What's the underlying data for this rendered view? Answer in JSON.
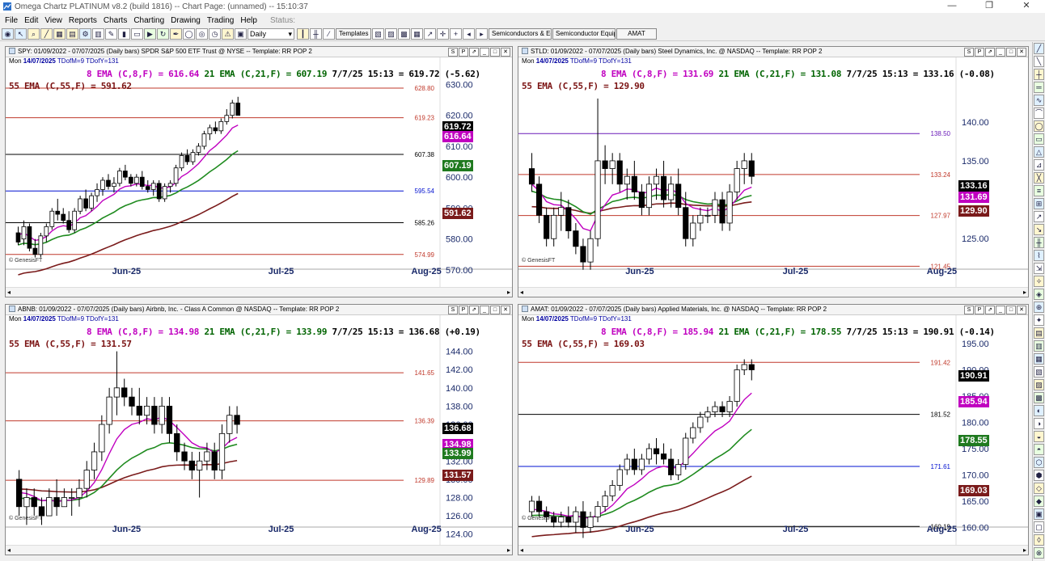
{
  "window": {
    "title": "Omega Chartz PLATINUM v8.2 (build 1816)  --  Chart Page: (unnamed) -- 15:10:37",
    "minimize": "—",
    "restore": "❐",
    "close": "✕"
  },
  "menu": [
    "File",
    "Edit",
    "View",
    "Reports",
    "Charts",
    "Charting",
    "Drawing",
    "Trading",
    "Help"
  ],
  "status_label": "Status:",
  "toolbar": {
    "period": "Daily",
    "templates": "Templates",
    "sym1": "Semiconductors & Equi",
    "sym2": "Semiconductor Equipm",
    "sym3": "AMAT"
  },
  "colors": {
    "ema8": "#c000c0",
    "ema21": "#1f8b1f",
    "ema55": "#7a1b1b",
    "price_line": "#000000",
    "sr_line": "#c0392b",
    "blue_line": "#0010d0",
    "purple_line": "#6a1bb8"
  },
  "panes": [
    {
      "id": "spy",
      "header": "SPY: 01/09/2022 - 07/07/2025  (Daily bars)   SPDR S&P 500 ETF Trust @ NYSE  --  Template: RR POP 2",
      "date_line": {
        "day": "Mon",
        "date": "14/07/2025",
        "tdm": "TDofM=9",
        "tdy": "TDofY=131"
      },
      "ema8": "8 EMA (C,8,F) = 616.64",
      "ema21": "21 EMA (C,21,F) = 607.19",
      "quote": "7/7/25 15:13 = 619.72 (-5.62)",
      "ema55": "55 EMA (C,55,F) = 591.62",
      "yaxis": {
        "min": 565,
        "max": 633,
        "ticks": [
          "570.00",
          "580.00",
          "590.00",
          "600.00",
          "610.00",
          "620.00",
          "630.00"
        ]
      },
      "hlines": [
        {
          "v": 628.8,
          "label": "628.80",
          "c": "#c0392b"
        },
        {
          "v": 619.23,
          "label": "619.23",
          "c": "#c0392b"
        },
        {
          "v": 607.38,
          "label": "607.38",
          "c": "#000000"
        },
        {
          "v": 595.54,
          "label": "595.54",
          "c": "#0010d0"
        },
        {
          "v": 585.26,
          "label": "585.26",
          "c": "#000000"
        },
        {
          "v": 574.99,
          "label": "574.99",
          "c": "#c0392b"
        }
      ],
      "tags": [
        {
          "v": 619.72,
          "label": "619.72",
          "bg": "#000000"
        },
        {
          "v": 616.64,
          "label": "616.64",
          "bg": "#c000c0"
        },
        {
          "v": 607.19,
          "label": "607.19",
          "bg": "#1f7a1f"
        },
        {
          "v": 591.62,
          "label": "591.62",
          "bg": "#7a1b1b"
        }
      ],
      "xlabels": [
        "Jun-25",
        "Jul-25",
        "Aug-25"
      ],
      "gf": "© GenesisFT",
      "candles": [
        [
          582,
          584,
          578,
          579
        ],
        [
          580,
          586,
          578,
          584
        ],
        [
          584,
          585,
          576,
          577
        ],
        [
          577,
          580,
          574,
          575
        ],
        [
          575,
          582,
          574,
          581
        ],
        [
          581,
          585,
          579,
          584
        ],
        [
          584,
          590,
          583,
          589
        ],
        [
          589,
          593,
          586,
          588
        ],
        [
          588,
          590,
          585,
          586
        ],
        [
          586,
          589,
          582,
          583
        ],
        [
          583,
          590,
          582,
          589
        ],
        [
          589,
          594,
          588,
          593
        ],
        [
          593,
          596,
          589,
          590
        ],
        [
          590,
          595,
          589,
          594
        ],
        [
          594,
          598,
          592,
          596
        ],
        [
          596,
          600,
          594,
          599
        ],
        [
          599,
          601,
          596,
          597
        ],
        [
          597,
          600,
          595,
          598
        ],
        [
          598,
          603,
          597,
          602
        ],
        [
          602,
          604,
          599,
          600
        ],
        [
          600,
          601,
          597,
          598
        ],
        [
          598,
          601,
          597,
          600
        ],
        [
          600,
          602,
          596,
          597
        ],
        [
          597,
          599,
          595,
          596
        ],
        [
          596,
          599,
          594,
          598
        ],
        [
          598,
          599,
          592,
          593
        ],
        [
          593,
          598,
          592,
          597
        ],
        [
          597,
          599,
          595,
          598
        ],
        [
          598,
          604,
          597,
          603
        ],
        [
          603,
          608,
          602,
          607
        ],
        [
          607,
          609,
          604,
          605
        ],
        [
          605,
          609,
          604,
          608
        ],
        [
          608,
          611,
          607,
          610
        ],
        [
          610,
          615,
          609,
          614
        ],
        [
          614,
          617,
          612,
          616
        ],
        [
          616,
          618,
          614,
          615
        ],
        [
          615,
          619,
          614,
          618
        ],
        [
          618,
          622,
          617,
          620
        ],
        [
          620,
          625,
          619,
          624
        ],
        [
          624,
          626,
          620,
          620
        ]
      ],
      "ema8_start": 582,
      "ema21_start": 578,
      "ema55_start": 568
    },
    {
      "id": "stld",
      "header": "STLD: 01/09/2022 - 07/07/2025  (Daily bars)   Steel Dynamics, Inc. @ NASDAQ  --  Template: RR POP 2",
      "date_line": {
        "day": "Mon",
        "date": "14/07/2025",
        "tdm": "TDofM=9",
        "tdy": "TDofY=131"
      },
      "ema8": "8 EMA (C,8,F) = 131.69",
      "ema21": "21 EMA (C,21,F) = 131.08",
      "quote": "7/7/25 15:13 = 133.16 (-0.08)",
      "ema55": "55 EMA (C,55,F) = 129.90",
      "yaxis": {
        "min": 119,
        "max": 146,
        "ticks": [
          "125.00",
          "130.00",
          "135.00",
          "140.00"
        ]
      },
      "hlines": [
        {
          "v": 138.5,
          "label": "138.50",
          "c": "#6a1bb8"
        },
        {
          "v": 133.24,
          "label": "133.24",
          "c": "#c0392b"
        },
        {
          "v": 127.97,
          "label": "127.97",
          "c": "#c0392b"
        },
        {
          "v": 121.45,
          "label": "121.45",
          "c": "#c0392b"
        }
      ],
      "tags": [
        {
          "v": 133.16,
          "label": "133.16",
          "bg": "#000000"
        },
        {
          "v": 131.69,
          "label": "131.69",
          "bg": "#c000c0"
        },
        {
          "v": 129.9,
          "label": "129.90",
          "bg": "#7a1b1b"
        }
      ],
      "xlabels": [
        "Jun-25",
        "Jul-25",
        "Aug-25"
      ],
      "gf": "© GenesisFT",
      "candles": [
        [
          134,
          136,
          131,
          132
        ],
        [
          132,
          133,
          127,
          128
        ],
        [
          128,
          129,
          124,
          125
        ],
        [
          125,
          129,
          124,
          128
        ],
        [
          128,
          131,
          126,
          129
        ],
        [
          129,
          130,
          125,
          126
        ],
        [
          126,
          127,
          123,
          124
        ],
        [
          124,
          125,
          121,
          122
        ],
        [
          122,
          126,
          121,
          125
        ],
        [
          125,
          143,
          124,
          135
        ],
        [
          135,
          137,
          132,
          134
        ],
        [
          134,
          136,
          132,
          135
        ],
        [
          135,
          136,
          131,
          132
        ],
        [
          132,
          134,
          130,
          133
        ],
        [
          133,
          135,
          130,
          131
        ],
        [
          131,
          132,
          128,
          129
        ],
        [
          129,
          133,
          128,
          132
        ],
        [
          132,
          134,
          130,
          133
        ],
        [
          133,
          135,
          129,
          130
        ],
        [
          130,
          133,
          129,
          132
        ],
        [
          132,
          134,
          128,
          129
        ],
        [
          129,
          131,
          124,
          125
        ],
        [
          125,
          128,
          124,
          127
        ],
        [
          127,
          129,
          126,
          128
        ],
        [
          128,
          129,
          127,
          128
        ],
        [
          128,
          131,
          127,
          130
        ],
        [
          130,
          131,
          126,
          127
        ],
        [
          127,
          132,
          126,
          131
        ],
        [
          131,
          135,
          130,
          134
        ],
        [
          134,
          136,
          132,
          135
        ],
        [
          135,
          136,
          132,
          133
        ]
      ],
      "ema8_start": 132,
      "ema21_start": 131,
      "ema55_start": 129
    },
    {
      "id": "abnb",
      "header": "ABNB: 01/09/2022 - 07/07/2025  (Daily bars)   Airbnb, Inc. - Class A Common @ NASDAQ  --  Template: RR POP 2",
      "date_line": {
        "day": "Mon",
        "date": "14/07/2025",
        "tdm": "TDofM=9",
        "tdy": "TDofY=131"
      },
      "ema8": "8 EMA (C,8,F) = 134.98",
      "ema21": "21 EMA (C,21,F) = 133.99",
      "quote": "7/7/25 15:13 = 136.68 (+0.19)",
      "ema55": "55 EMA (C,55,F) = 131.57",
      "yaxis": {
        "min": 123,
        "max": 146,
        "ticks": [
          "124.00",
          "126.00",
          "128.00",
          "130.00",
          "132.00",
          "134.00",
          "136.00",
          "138.00",
          "140.00",
          "142.00",
          "144.00"
        ]
      },
      "hlines": [
        {
          "v": 141.65,
          "label": "141.65",
          "c": "#c0392b"
        },
        {
          "v": 136.39,
          "label": "136.39",
          "c": "#c0392b"
        },
        {
          "v": 129.89,
          "label": "129.89",
          "c": "#c0392b"
        }
      ],
      "tags": [
        {
          "v": 136.68,
          "label": "136.68",
          "bg": "#000000"
        },
        {
          "v": 134.98,
          "label": "134.98",
          "bg": "#c000c0"
        },
        {
          "v": 133.99,
          "label": "133.99",
          "bg": "#1f7a1f"
        },
        {
          "v": 131.57,
          "label": "131.57",
          "bg": "#7a1b1b"
        }
      ],
      "xlabels": [
        "Jun-25",
        "Jul-25",
        "Aug-25"
      ],
      "gf": "© GenesisFT",
      "candles": [
        [
          130,
          131,
          126,
          127
        ],
        [
          127,
          129,
          125,
          128
        ],
        [
          128,
          129,
          126,
          127
        ],
        [
          127,
          128,
          125,
          126
        ],
        [
          126,
          129,
          126,
          128
        ],
        [
          128,
          130,
          126,
          127
        ],
        [
          127,
          129,
          127,
          128
        ],
        [
          128,
          129,
          126,
          128
        ],
        [
          128,
          130,
          127,
          129
        ],
        [
          129,
          132,
          128,
          131
        ],
        [
          131,
          134,
          130,
          133
        ],
        [
          133,
          137,
          132,
          136
        ],
        [
          136,
          140,
          135,
          139
        ],
        [
          139,
          144,
          137,
          140
        ],
        [
          140,
          141,
          138,
          139
        ],
        [
          139,
          140,
          137,
          138
        ],
        [
          138,
          140,
          136,
          137
        ],
        [
          137,
          139,
          136,
          138
        ],
        [
          138,
          139,
          135,
          136
        ],
        [
          136,
          139,
          135,
          138
        ],
        [
          138,
          139,
          134,
          135
        ],
        [
          135,
          136,
          132,
          133
        ],
        [
          133,
          134,
          131,
          132
        ],
        [
          132,
          133,
          130,
          131
        ],
        [
          131,
          133,
          128,
          132
        ],
        [
          132,
          134,
          131,
          133
        ],
        [
          133,
          134,
          130,
          131
        ],
        [
          131,
          136,
          130,
          135
        ],
        [
          135,
          138,
          134,
          137
        ],
        [
          137,
          138,
          135,
          136
        ]
      ],
      "ema8_start": 129,
      "ema21_start": 128,
      "ema55_start": 129
    },
    {
      "id": "amat",
      "header": "AMAT: 01/09/2022 - 07/07/2025  (Daily bars)   Applied Materials, Inc. @ NASDAQ  --  Template: RR POP 2",
      "date_line": {
        "day": "Mon",
        "date": "14/07/2025",
        "tdm": "TDofM=9",
        "tdy": "TDofY=131"
      },
      "ema8": "8 EMA (C,8,F) = 185.94",
      "ema21": "21 EMA (C,21,F) = 178.55",
      "quote": "7/7/25 15:13 = 190.91 (-0.14)",
      "ema55": "55 EMA (C,55,F) = 169.03",
      "yaxis": {
        "min": 157,
        "max": 197,
        "ticks": [
          "160.00",
          "165.00",
          "170.00",
          "175.00",
          "180.00",
          "185.00",
          "190.00",
          "195.00"
        ]
      },
      "hlines": [
        {
          "v": 191.42,
          "label": "191.42",
          "c": "#c0392b"
        },
        {
          "v": 181.52,
          "label": "181.52",
          "c": "#000000"
        },
        {
          "v": 171.61,
          "label": "171.61",
          "c": "#0010d0"
        },
        {
          "v": 160.19,
          "label": "160.19",
          "c": "#000000"
        }
      ],
      "tags": [
        {
          "v": 190.91,
          "label": "190.91",
          "bg": "#000000"
        },
        {
          "v": 185.94,
          "label": "185.94",
          "bg": "#c000c0"
        },
        {
          "v": 178.55,
          "label": "178.55",
          "bg": "#1f7a1f"
        },
        {
          "v": 169.03,
          "label": "169.03",
          "bg": "#7a1b1b"
        }
      ],
      "xlabels": [
        "Jun-25",
        "Jul-25",
        "Aug-25"
      ],
      "gf": "© GenesisFT",
      "candles": [
        [
          163,
          166,
          162,
          165
        ],
        [
          165,
          166,
          162,
          163
        ],
        [
          163,
          164,
          161,
          162
        ],
        [
          162,
          163,
          160,
          161
        ],
        [
          161,
          163,
          160,
          162
        ],
        [
          162,
          164,
          160,
          161
        ],
        [
          161,
          164,
          159,
          163
        ],
        [
          163,
          165,
          158,
          160
        ],
        [
          160,
          163,
          159,
          162
        ],
        [
          162,
          165,
          161,
          164
        ],
        [
          164,
          167,
          163,
          166
        ],
        [
          166,
          169,
          165,
          168
        ],
        [
          168,
          172,
          167,
          171
        ],
        [
          171,
          174,
          170,
          173
        ],
        [
          173,
          175,
          170,
          171
        ],
        [
          171,
          174,
          170,
          173
        ],
        [
          173,
          176,
          172,
          175
        ],
        [
          175,
          177,
          172,
          174
        ],
        [
          174,
          176,
          172,
          173
        ],
        [
          173,
          175,
          169,
          170
        ],
        [
          170,
          173,
          169,
          172
        ],
        [
          172,
          178,
          171,
          177
        ],
        [
          177,
          180,
          176,
          179
        ],
        [
          179,
          182,
          178,
          181
        ],
        [
          181,
          183,
          180,
          182
        ],
        [
          182,
          184,
          181,
          183
        ],
        [
          183,
          184,
          181,
          182
        ],
        [
          182,
          185,
          181,
          184
        ],
        [
          184,
          191,
          183,
          190
        ],
        [
          190,
          192,
          189,
          191
        ],
        [
          191,
          192,
          188,
          190
        ]
      ],
      "ema8_start": 163,
      "ema21_start": 162,
      "ema55_start": 158
    }
  ]
}
